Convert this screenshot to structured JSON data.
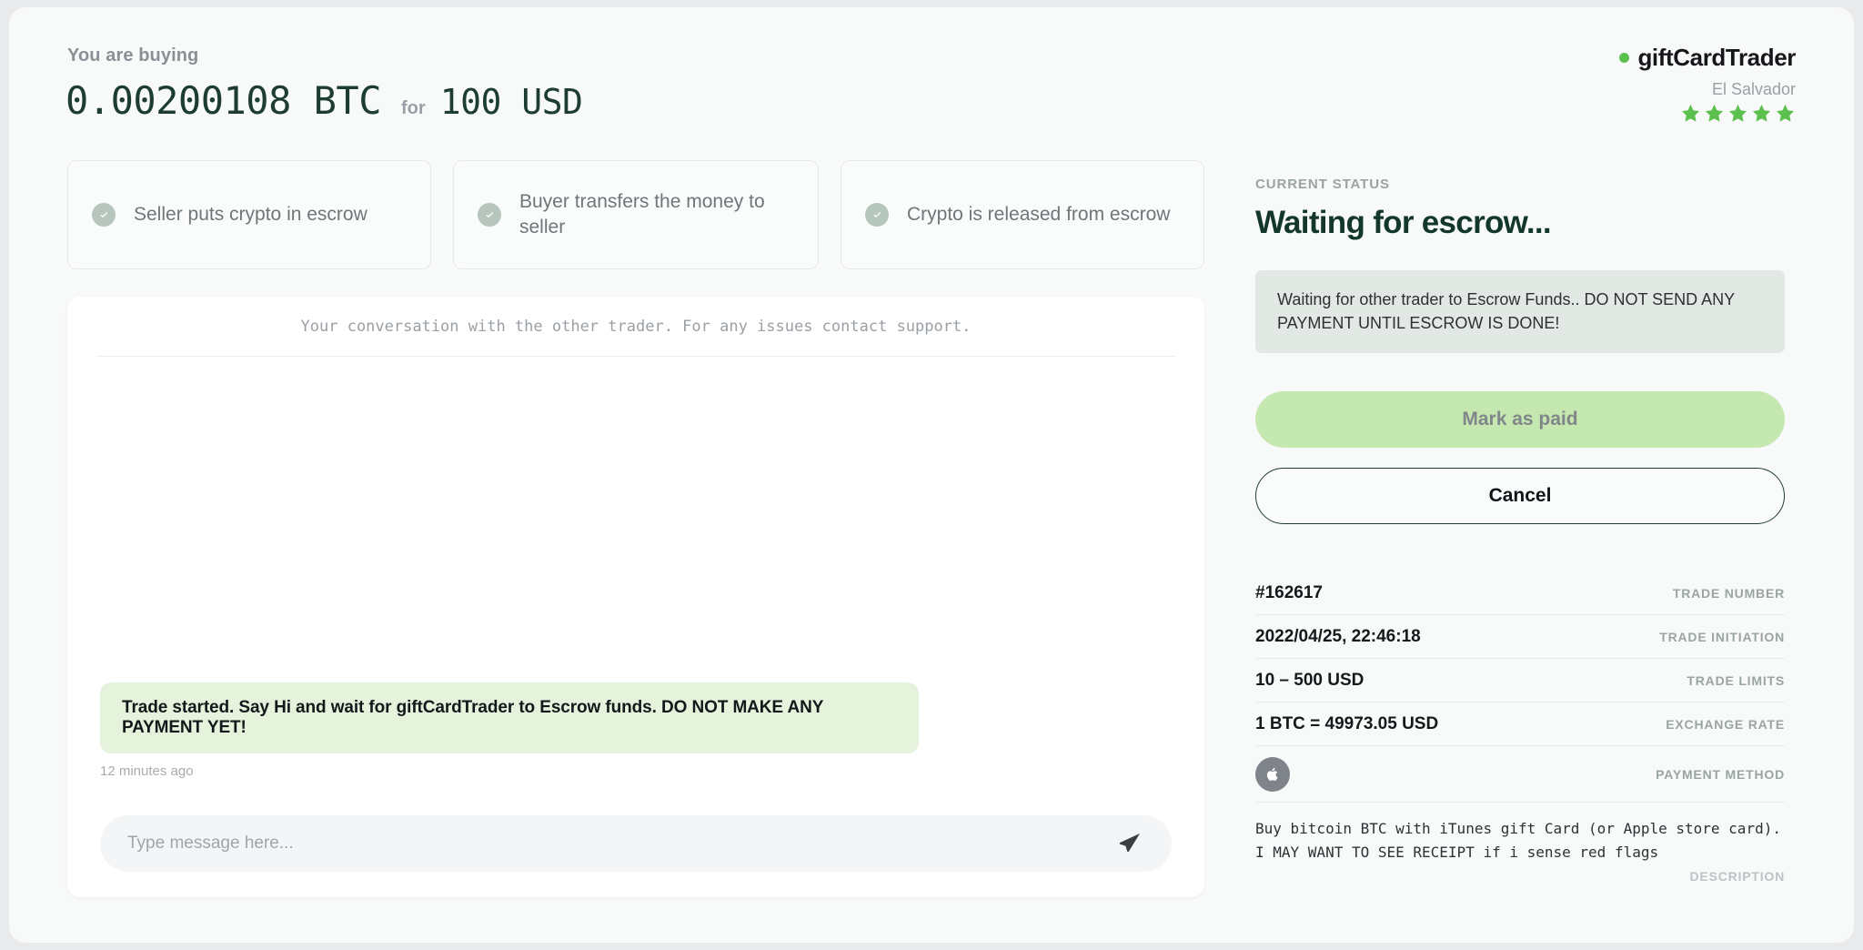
{
  "header": {
    "buying_label": "You are buying",
    "crypto_amount": "0.00200108 BTC",
    "for_label": "for",
    "fiat_amount": "100 USD"
  },
  "brand": {
    "online_icon": "online-dot-icon",
    "name": "giftCardTrader",
    "country": "El Salvador",
    "rating": 5,
    "star_color": "#5cc04f"
  },
  "steps": [
    {
      "icon": "check-circle-icon",
      "label": "Seller puts crypto in escrow"
    },
    {
      "icon": "check-circle-icon",
      "label": "Buyer transfers the money to seller"
    },
    {
      "icon": "check-circle-icon",
      "label": "Crypto is released from escrow"
    }
  ],
  "chat": {
    "header_note": "Your conversation with the other trader. For any issues contact support.",
    "messages": [
      {
        "text": "Trade started. Say Hi and wait for giftCardTrader to Escrow funds. DO NOT MAKE ANY PAYMENT YET!",
        "time": "12 minutes ago"
      }
    ],
    "input_placeholder": "Type message here...",
    "input_value": "",
    "send_icon": "send-paper-plane-icon"
  },
  "status": {
    "eyebrow": "CURRENT STATUS",
    "title": "Waiting for escrow...",
    "note": "Waiting for other trader to Escrow Funds.. DO NOT SEND ANY PAYMENT UNTIL ESCROW IS DONE!",
    "mark_paid_label": "Mark as paid",
    "cancel_label": "Cancel",
    "mark_paid_color": "#c5e8b0"
  },
  "details": [
    {
      "value": "#162617",
      "key": "TRADE NUMBER"
    },
    {
      "value": "2022/04/25, 22:46:18",
      "key": "TRADE INITIATION"
    },
    {
      "value": "10 – 500 USD",
      "key": "TRADE LIMITS"
    },
    {
      "value": "1 BTC = 49973.05 USD",
      "key": "EXCHANGE RATE"
    }
  ],
  "payment_method": {
    "icon": "apple-icon",
    "key": "PAYMENT METHOD"
  },
  "description": {
    "text": "Buy bitcoin BTC with iTunes gift Card (or Apple store card).\nI MAY WANT TO SEE RECEIPT if i sense red flags",
    "key": "DESCRIPTION"
  }
}
